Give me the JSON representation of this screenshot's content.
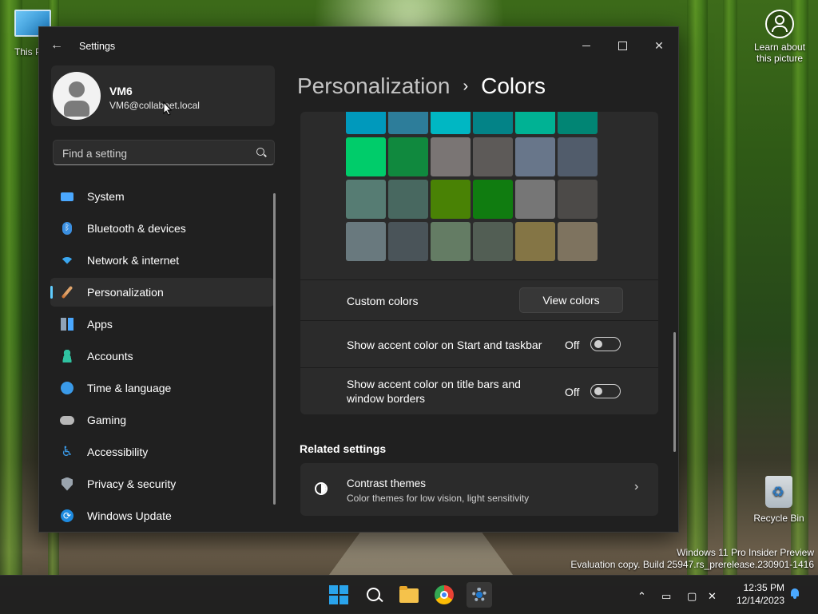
{
  "desktop": {
    "this_pc_label": "This P",
    "learn_label": "Learn about this picture",
    "recycle_label": "Recycle Bin",
    "watermark_line1": "Windows 11 Pro Insider Preview",
    "watermark_line2": "Evaluation copy. Build 25947.rs_prerelease.230901-1416"
  },
  "window": {
    "title": "Settings"
  },
  "profile": {
    "name": "VM6",
    "email": "VM6@collabnet.local"
  },
  "search": {
    "placeholder": "Find a setting"
  },
  "nav": {
    "items": [
      {
        "label": "System",
        "icon": "monitor-icon",
        "color": "#4aa8ff"
      },
      {
        "label": "Bluetooth & devices",
        "icon": "bluetooth-icon",
        "color": "#3b8fe0"
      },
      {
        "label": "Network & internet",
        "icon": "wifi-icon",
        "color": "#3aa6ef"
      },
      {
        "label": "Personalization",
        "icon": "brush-icon",
        "color": "#e0a46b",
        "active": true
      },
      {
        "label": "Apps",
        "icon": "apps-icon",
        "color": "#8fa3b8"
      },
      {
        "label": "Accounts",
        "icon": "person-icon",
        "color": "#2fc2a0"
      },
      {
        "label": "Time & language",
        "icon": "globe-clock-icon",
        "color": "#3a9ae8"
      },
      {
        "label": "Gaming",
        "icon": "gamepad-icon",
        "color": "#b7b7b7"
      },
      {
        "label": "Accessibility",
        "icon": "accessibility-icon",
        "color": "#3a9ae8"
      },
      {
        "label": "Privacy & security",
        "icon": "shield-icon",
        "color": "#9aa4ae"
      },
      {
        "label": "Windows Update",
        "icon": "update-icon",
        "color": "#1e8be0"
      }
    ]
  },
  "breadcrumb": {
    "parent": "Personalization",
    "separator": "›",
    "current": "Colors"
  },
  "palette": {
    "rows": [
      [
        "#0099bc",
        "#2d7d9a",
        "#00b7c3",
        "#038387",
        "#00b294",
        "#018574"
      ],
      [
        "#00cc6a",
        "#10893e",
        "#7a7574",
        "#5d5a58",
        "#68768a",
        "#515c6b"
      ],
      [
        "#567c73",
        "#486860",
        "#498205",
        "#107c10",
        "#767676",
        "#4c4a48"
      ],
      [
        "#69797e",
        "#4a5459",
        "#647c64",
        "#525e54",
        "#847545",
        "#7e735f"
      ]
    ]
  },
  "custom_colors": {
    "label": "Custom colors",
    "button": "View colors"
  },
  "accent_taskbar": {
    "label": "Show accent color on Start and taskbar",
    "state": "Off"
  },
  "accent_titlebar": {
    "label_line1": "Show accent color on title bars and",
    "label_line2": "window borders",
    "state": "Off"
  },
  "related": {
    "title": "Related settings",
    "contrast_title": "Contrast themes",
    "contrast_sub": "Color themes for low vision, light sensitivity"
  },
  "taskbar": {
    "time": "12:35 PM",
    "date": "12/14/2023"
  }
}
